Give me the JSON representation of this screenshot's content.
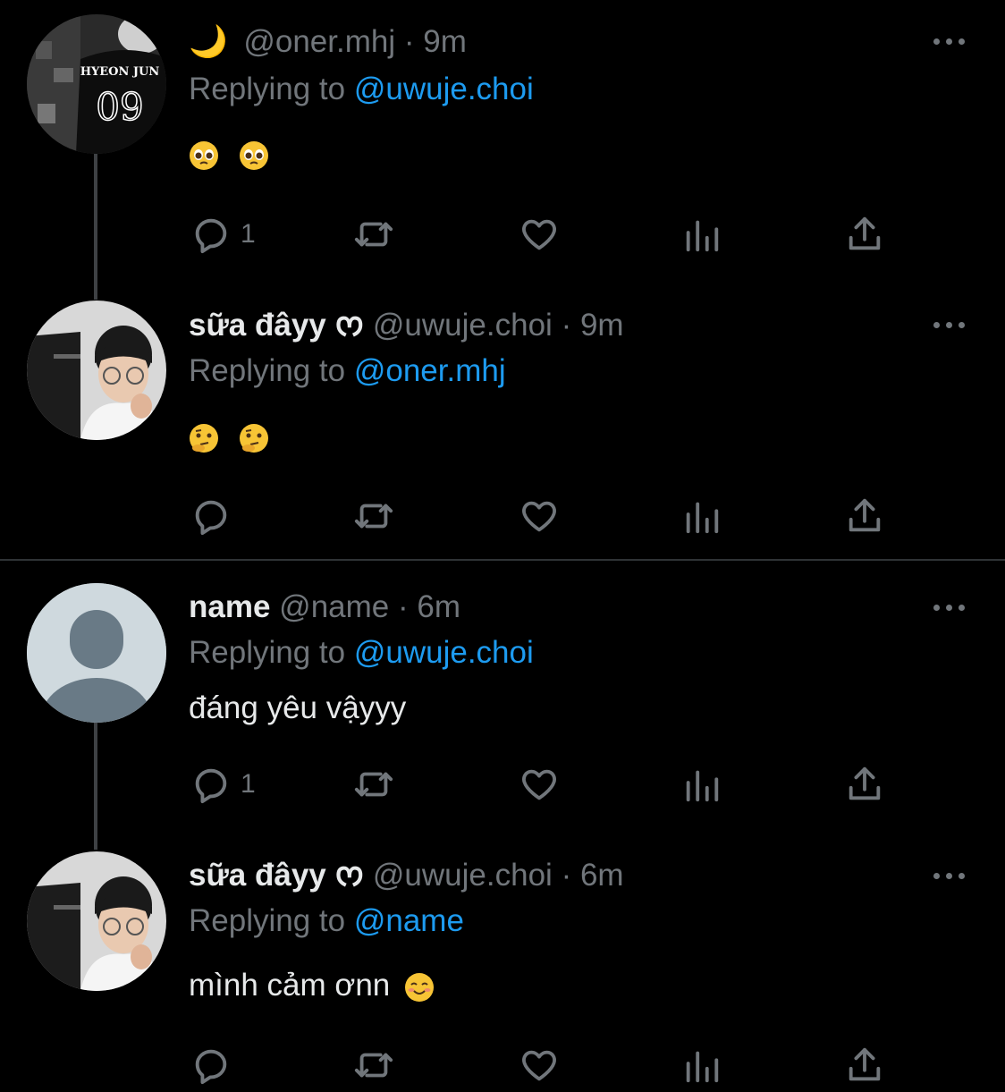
{
  "tweets": [
    {
      "display_name": "",
      "name_emoji": "🌙",
      "handle": "@oner.mhj",
      "dot": "·",
      "time": "9m",
      "replying_label": "Replying to",
      "replying_to": "@uwuje.choi",
      "body_emojis": [
        "pleading-face",
        "pleading-face"
      ],
      "reply_count": "1",
      "avatar_jersey_name": "HYEON JUN",
      "avatar_jersey_number": "09"
    },
    {
      "display_name": "sữa đâyy",
      "name_emoji": "ᰔ",
      "handle": "@uwuje.choi",
      "dot": "·",
      "time": "9m",
      "replying_label": "Replying to",
      "replying_to": "@oner.mhj",
      "body_emojis": [
        "thinking-face",
        "thinking-face"
      ],
      "reply_count": ""
    },
    {
      "display_name": "name",
      "handle": "@name",
      "dot": "·",
      "time": "6m",
      "replying_label": "Replying to",
      "replying_to": "@uwuje.choi",
      "body_text": "đáng yêu vậyyy",
      "reply_count": "1"
    },
    {
      "display_name": "sữa đâyy",
      "name_emoji": "ᰔ",
      "handle": "@uwuje.choi",
      "dot": "·",
      "time": "6m",
      "replying_label": "Replying to",
      "replying_to": "@name",
      "body_text": "mình cảm ơnn",
      "body_emojis": [
        "smiling-face"
      ],
      "reply_count": ""
    }
  ],
  "icons": {
    "reply": "reply-icon",
    "retweet": "retweet-icon",
    "like": "heart-icon",
    "views": "views-icon",
    "share": "share-icon",
    "more": "more-icon"
  },
  "colors": {
    "background": "#000000",
    "text": "#e7e9ea",
    "muted": "#71767b",
    "accent": "#1d9bf0",
    "emoji": "#f7c435"
  }
}
